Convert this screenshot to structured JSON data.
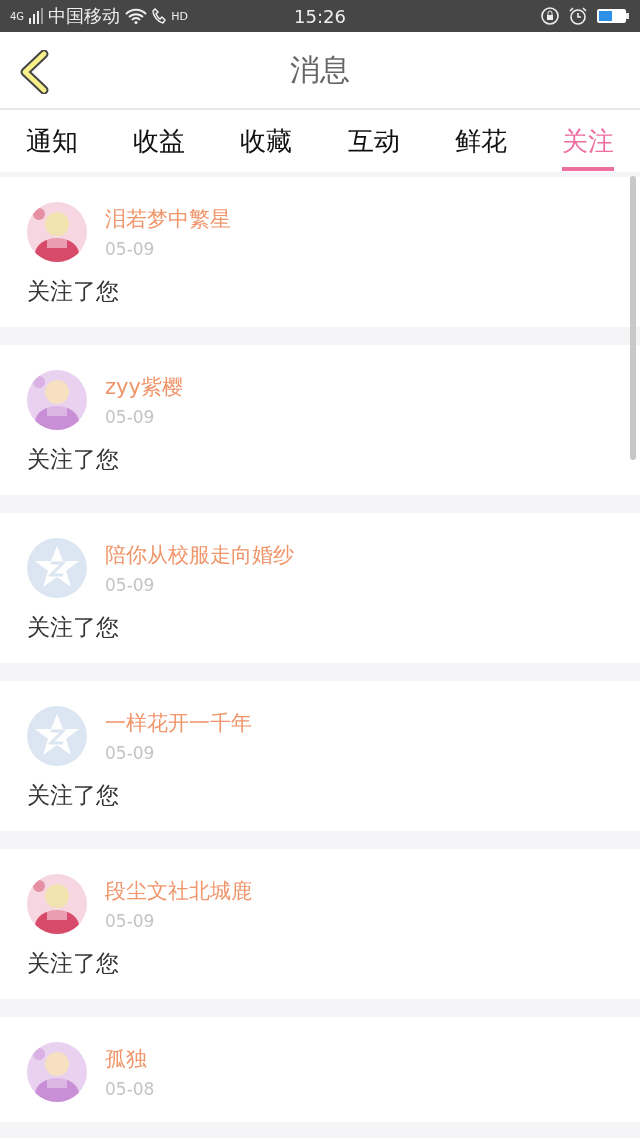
{
  "status_bar": {
    "network": "4G",
    "carrier": "中国移动",
    "call_badge": "HD",
    "time": "15:26"
  },
  "header": {
    "title": "消息"
  },
  "tabs": [
    {
      "label": "通知",
      "selected": false
    },
    {
      "label": "收益",
      "selected": false
    },
    {
      "label": "收藏",
      "selected": false
    },
    {
      "label": "互动",
      "selected": false
    },
    {
      "label": "鲜花",
      "selected": false
    },
    {
      "label": "关注",
      "selected": true
    }
  ],
  "messages": [
    {
      "name": "泪若梦中繁星",
      "date": "05-09",
      "text": "关注了您"
    },
    {
      "name": "zyy紫樱",
      "date": "05-09",
      "text": "关注了您"
    },
    {
      "avatar": {
        "kind": "default"
      },
      "name": "陪你从校服走向婚纱",
      "date": "05-09",
      "text": "关注了您"
    },
    {
      "avatar": {
        "kind": "default"
      },
      "name": "一样花开一千年",
      "date": "05-09",
      "text": "关注了您"
    },
    {
      "name": "段尘文社北城鹿",
      "date": "05-09",
      "text": "关注了您"
    },
    {
      "name": "孤独",
      "date": "05-08"
    }
  ]
}
